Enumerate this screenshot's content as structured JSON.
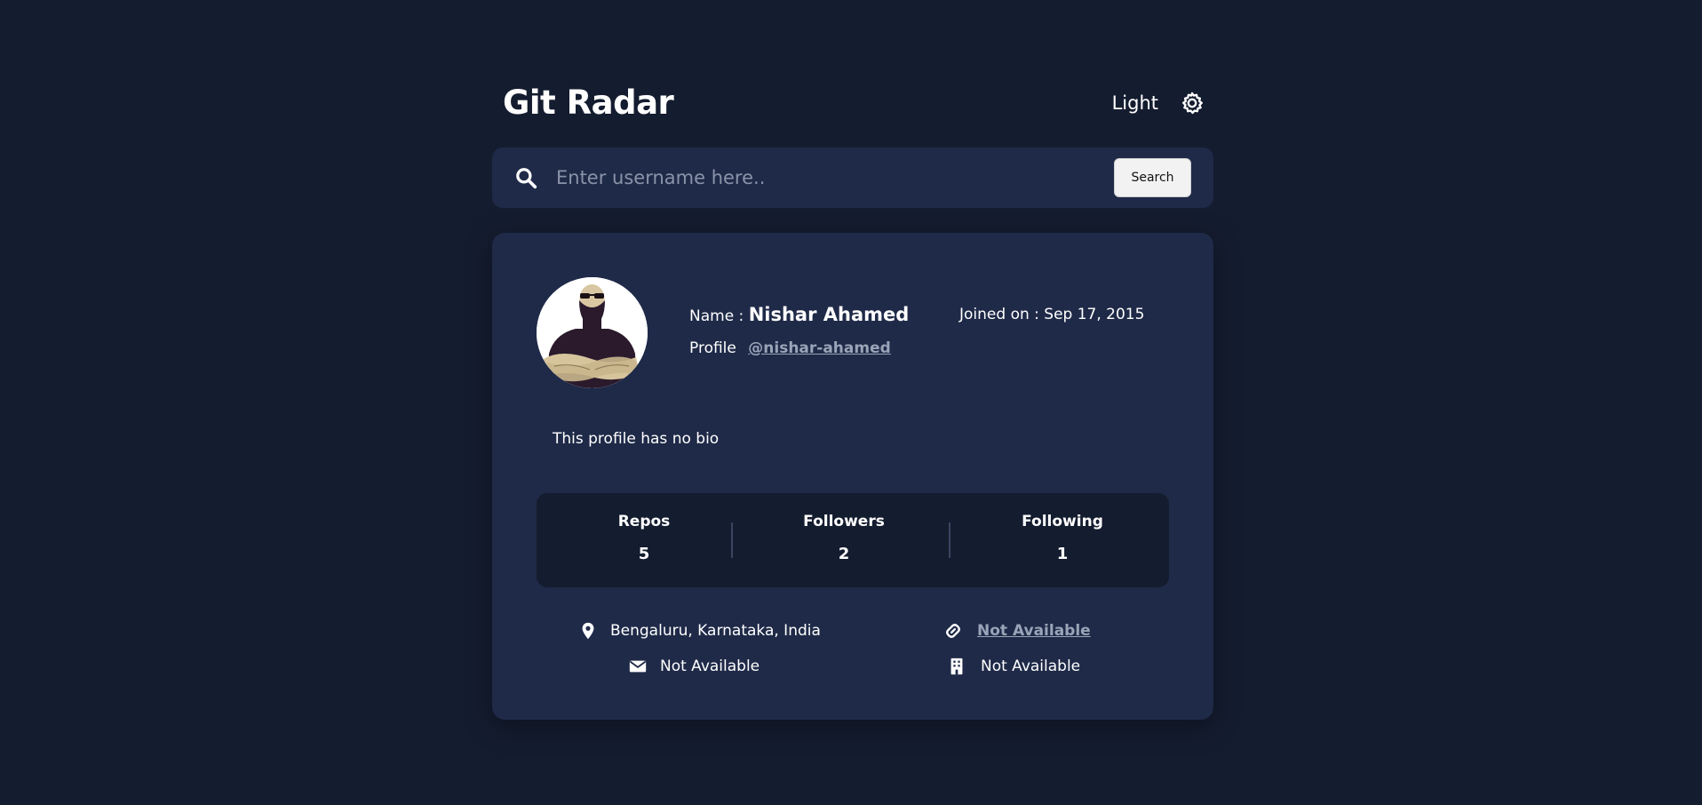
{
  "header": {
    "title": "Git Radar",
    "theme_label": "Light"
  },
  "search": {
    "placeholder": "Enter username here..",
    "value": "",
    "button_label": "Search"
  },
  "profile": {
    "name_label": "Name :",
    "name": "Nishar Ahamed",
    "profile_label": "Profile",
    "handle": "@nishar-ahamed",
    "joined_label": "Joined on :",
    "joined_date": "Sep 17, 2015",
    "bio": "This profile has no bio"
  },
  "stats": [
    {
      "label": "Repos",
      "value": "5"
    },
    {
      "label": "Followers",
      "value": "2"
    },
    {
      "label": "Following",
      "value": "1"
    }
  ],
  "info": {
    "location": "Bengaluru, Karnataka, India",
    "website": "Not Available",
    "email": "Not Available",
    "company": "Not Available"
  },
  "icons": {
    "theme": "gear-icon",
    "search": "search-icon",
    "location": "map-pin-icon",
    "website": "link-icon",
    "email": "envelope-icon",
    "company": "building-icon"
  },
  "colors": {
    "background": "#141c2f",
    "card": "#1f2a48",
    "text": "#ffffff",
    "muted_link": "#9aa4b8"
  }
}
